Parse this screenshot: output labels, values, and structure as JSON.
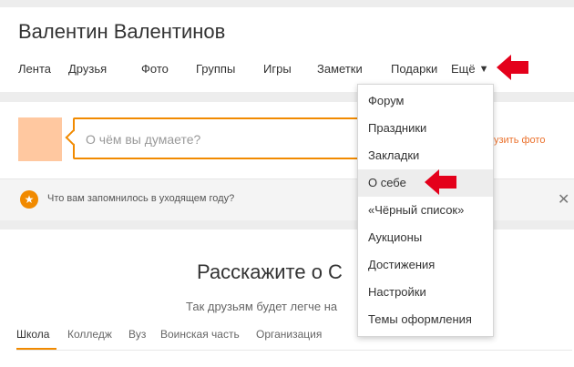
{
  "profile": {
    "name": "Валентин Валентинов"
  },
  "nav": {
    "items": [
      "Лента",
      "Друзья",
      "Фото",
      "Группы",
      "Игры",
      "Заметки",
      "Подарки"
    ],
    "more_label": "Ещё",
    "more_caret": "▼"
  },
  "post": {
    "placeholder": "О чём вы думаете?",
    "upload_label": "рузить фото"
  },
  "remember": {
    "text": "Что вам запомнилось в уходящем году?",
    "close_glyph": "✕",
    "icon_glyph": "★"
  },
  "about": {
    "title": "Расскажите о С",
    "subtitle": "Так друзьям будет легче на",
    "tabs": [
      "Школа",
      "Колледж",
      "Вуз",
      "Воинская часть",
      "Организация"
    ]
  },
  "more_menu": {
    "items": [
      "Форум",
      "Праздники",
      "Закладки",
      "О себе",
      "«Чёрный список»",
      "Аукционы",
      "Достижения",
      "Настройки",
      "Темы оформления"
    ],
    "highlighted_index": 3
  },
  "colors": {
    "accent": "#f18a00",
    "annotation": "#e4001b"
  }
}
